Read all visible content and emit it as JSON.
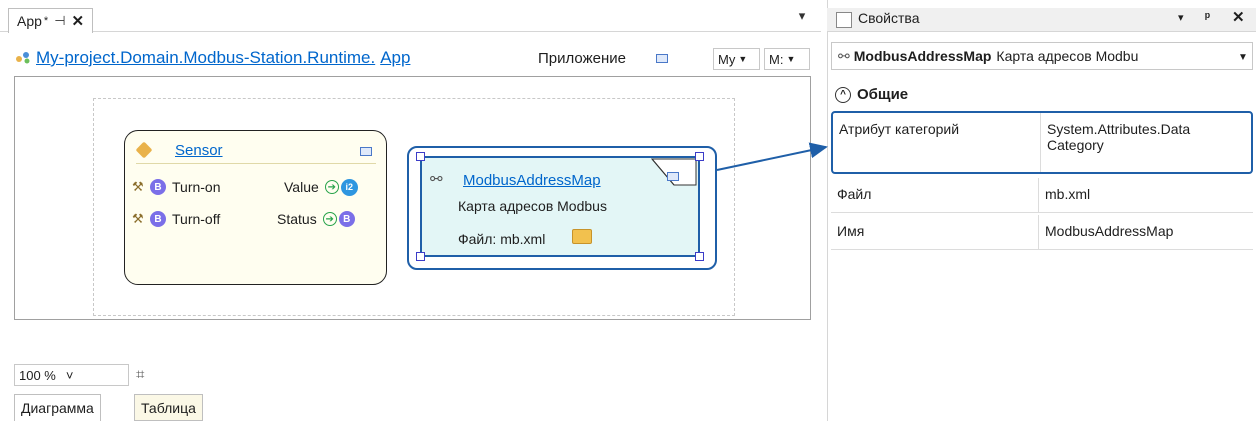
{
  "document_tab": {
    "label": "App",
    "modified_mark": "*",
    "pin_glyph": "⊣",
    "close_glyph": "✕",
    "overflow_glyph": "▾"
  },
  "breadcrumb": {
    "path": "My-project.Domain.Modbus-Station.Runtime.",
    "last": "App",
    "type_label": "Приложение",
    "combo1": "My",
    "combo2": "M:"
  },
  "sensor_block": {
    "title": "Sensor",
    "inputs": [
      {
        "badge": "B",
        "label": "Turn-on"
      },
      {
        "badge": "B",
        "label": "Turn-off"
      }
    ],
    "outputs": [
      {
        "label": "Value",
        "badge": "i2"
      },
      {
        "label": "Status",
        "badge": "B"
      }
    ]
  },
  "modbus_block": {
    "title": "ModbusAddressMap",
    "subtitle": "Карта адресов Modbus",
    "file_label": "Файл: mb.xml"
  },
  "zoom": {
    "value": "100 %",
    "arrow": "˅"
  },
  "view_tabs": [
    "Диаграмма",
    "Таблица"
  ],
  "properties_panel": {
    "title": "Свойства",
    "menu_glyph": "▾",
    "pin_glyph": "ᵖ",
    "close_glyph": "✕",
    "selected_object_name": "ModbusAddressMap",
    "selected_object_type": "Карта адресов Modbu",
    "group": "Общие",
    "rows": [
      {
        "name": "Атрибут категорий",
        "value": "System.Attributes.Data Category"
      },
      {
        "name": "Файл",
        "value": "mb.xml"
      },
      {
        "name": "Имя",
        "value": "ModbusAddressMap"
      }
    ]
  },
  "colors": {
    "link": "#0066cc",
    "selection": "#1f5fa8",
    "bool_badge": "#7b6fe8",
    "int_badge": "#2e96e0",
    "modbus_fill": "#e3f6f6",
    "sensor_fill": "#fffef0"
  },
  "icons": {
    "crumb": "project-icon",
    "sensor": "pencil-icon",
    "modbus": "address-map-icon",
    "folder": "folder-icon",
    "grid": "grid-icon",
    "properties": "properties-icon"
  }
}
